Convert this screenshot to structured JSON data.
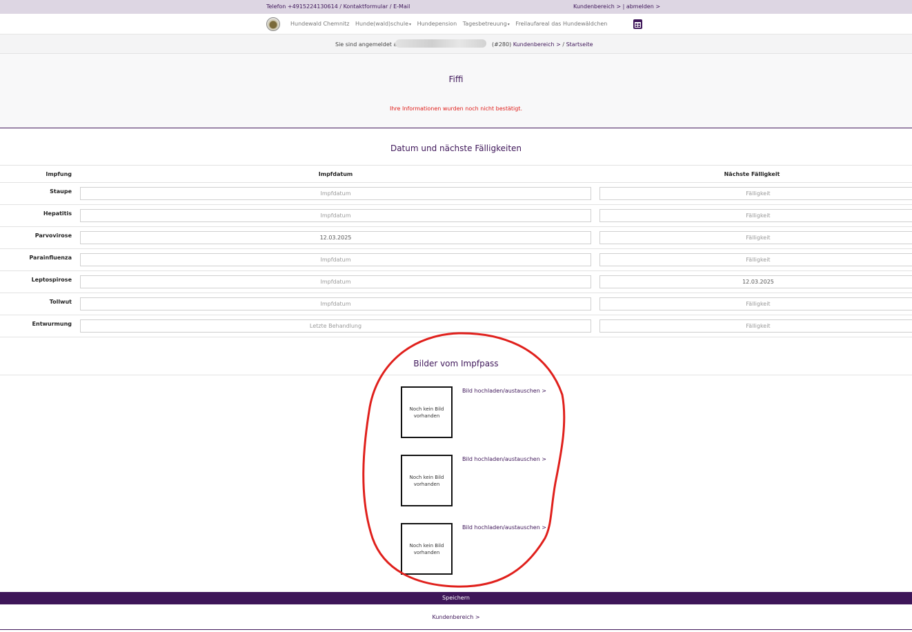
{
  "topbar": {
    "contact": "Telefon +4915224130614 / Kontaktformular / E-Mail",
    "account": "Kundenbereich > | abmelden >"
  },
  "nav": {
    "items": [
      "Hundewald Chemnitz",
      "Hunde(wald)schule",
      "Hundepension",
      "Tagesbetreuung",
      "Freilaufareal das Hundewäldchen"
    ],
    "calendar_icon": "calendar-icon"
  },
  "login": {
    "prefix": "Sie sind angemeldet als",
    "suffix": "(#280)",
    "breadcrumb_1": "Kundenbereich >",
    "sep": "/",
    "breadcrumb_2": "Startseite"
  },
  "dog": {
    "name": "Fiffi",
    "warning": "Ihre Informationen wurden noch nicht bestätigt."
  },
  "vaccinations": {
    "title": "Datum und nächste Fälligkeiten",
    "headers": {
      "type": "Impfung",
      "date": "Impfdatum",
      "due": "Nächste Fälligkeit"
    },
    "rows": [
      {
        "label": "Staupe",
        "date_value": "",
        "date_placeholder": "Impfdatum",
        "due_value": "",
        "due_placeholder": "Fälligkeit"
      },
      {
        "label": "Hepatitis",
        "date_value": "",
        "date_placeholder": "Impfdatum",
        "due_value": "",
        "due_placeholder": "Fälligkeit"
      },
      {
        "label": "Parvovirose",
        "date_value": "12.03.2025",
        "date_placeholder": "Impfdatum",
        "due_value": "",
        "due_placeholder": "Fälligkeit"
      },
      {
        "label": "Parainfluenza",
        "date_value": "",
        "date_placeholder": "Impfdatum",
        "due_value": "",
        "due_placeholder": "Fälligkeit"
      },
      {
        "label": "Leptospirose",
        "date_value": "",
        "date_placeholder": "Impfdatum",
        "due_value": "12.03.2025",
        "due_placeholder": "Fälligkeit"
      },
      {
        "label": "Tollwut",
        "date_value": "",
        "date_placeholder": "Impfdatum",
        "due_value": "",
        "due_placeholder": "Fälligkeit"
      },
      {
        "label": "Entwurmung",
        "date_value": "",
        "date_placeholder": "Letzte Behandlung",
        "due_value": "",
        "due_placeholder": "Fälligkeit"
      }
    ]
  },
  "images": {
    "title": "Bilder vom Impfpass",
    "slots": [
      {
        "placeholder": "Noch kein Bild vorhanden",
        "link": "Bild hochladen/austauschen >"
      },
      {
        "placeholder": "Noch kein Bild vorhanden",
        "link": "Bild hochladen/austauschen >"
      },
      {
        "placeholder": "Noch kein Bild vorhanden",
        "link": "Bild hochladen/austauschen >"
      }
    ]
  },
  "actions": {
    "save": "Speichern",
    "back": "Kundenbereich >"
  },
  "colors": {
    "brand": "#3e1659",
    "topbar_bg": "#ddd6e3",
    "warning": "#e0201c",
    "annotation": "#e0201c"
  }
}
